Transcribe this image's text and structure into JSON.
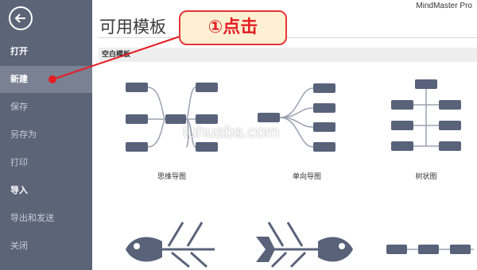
{
  "app": {
    "name": "MindMaster Pro"
  },
  "sidebar": {
    "items": [
      {
        "label": "打开"
      },
      {
        "label": "新建"
      },
      {
        "label": "保存"
      },
      {
        "label": "另存为"
      },
      {
        "label": "打印"
      },
      {
        "label": "导入"
      },
      {
        "label": "导出和发送"
      },
      {
        "label": "关闭"
      }
    ]
  },
  "main": {
    "title": "可用模板",
    "section": "空白模板",
    "templates": [
      {
        "label": "思维导图"
      },
      {
        "label": "单向导图"
      },
      {
        "label": "树状图"
      }
    ]
  },
  "annotation": {
    "text": "①点击",
    "color": "#e51d24"
  },
  "watermark": {
    "text": "tuhuaba.com"
  },
  "colors": {
    "sidebar": "#5c6478",
    "sidebar_active": "#7a8193",
    "node": "#58637a",
    "callout_fill": "#fdf0d2"
  },
  "icons": [
    "back-arrow-icon",
    "mind-map-icon",
    "one-way-map-icon",
    "tree-chart-icon",
    "fishbone-left-icon",
    "fishbone-right-icon",
    "timeline-icon"
  ]
}
